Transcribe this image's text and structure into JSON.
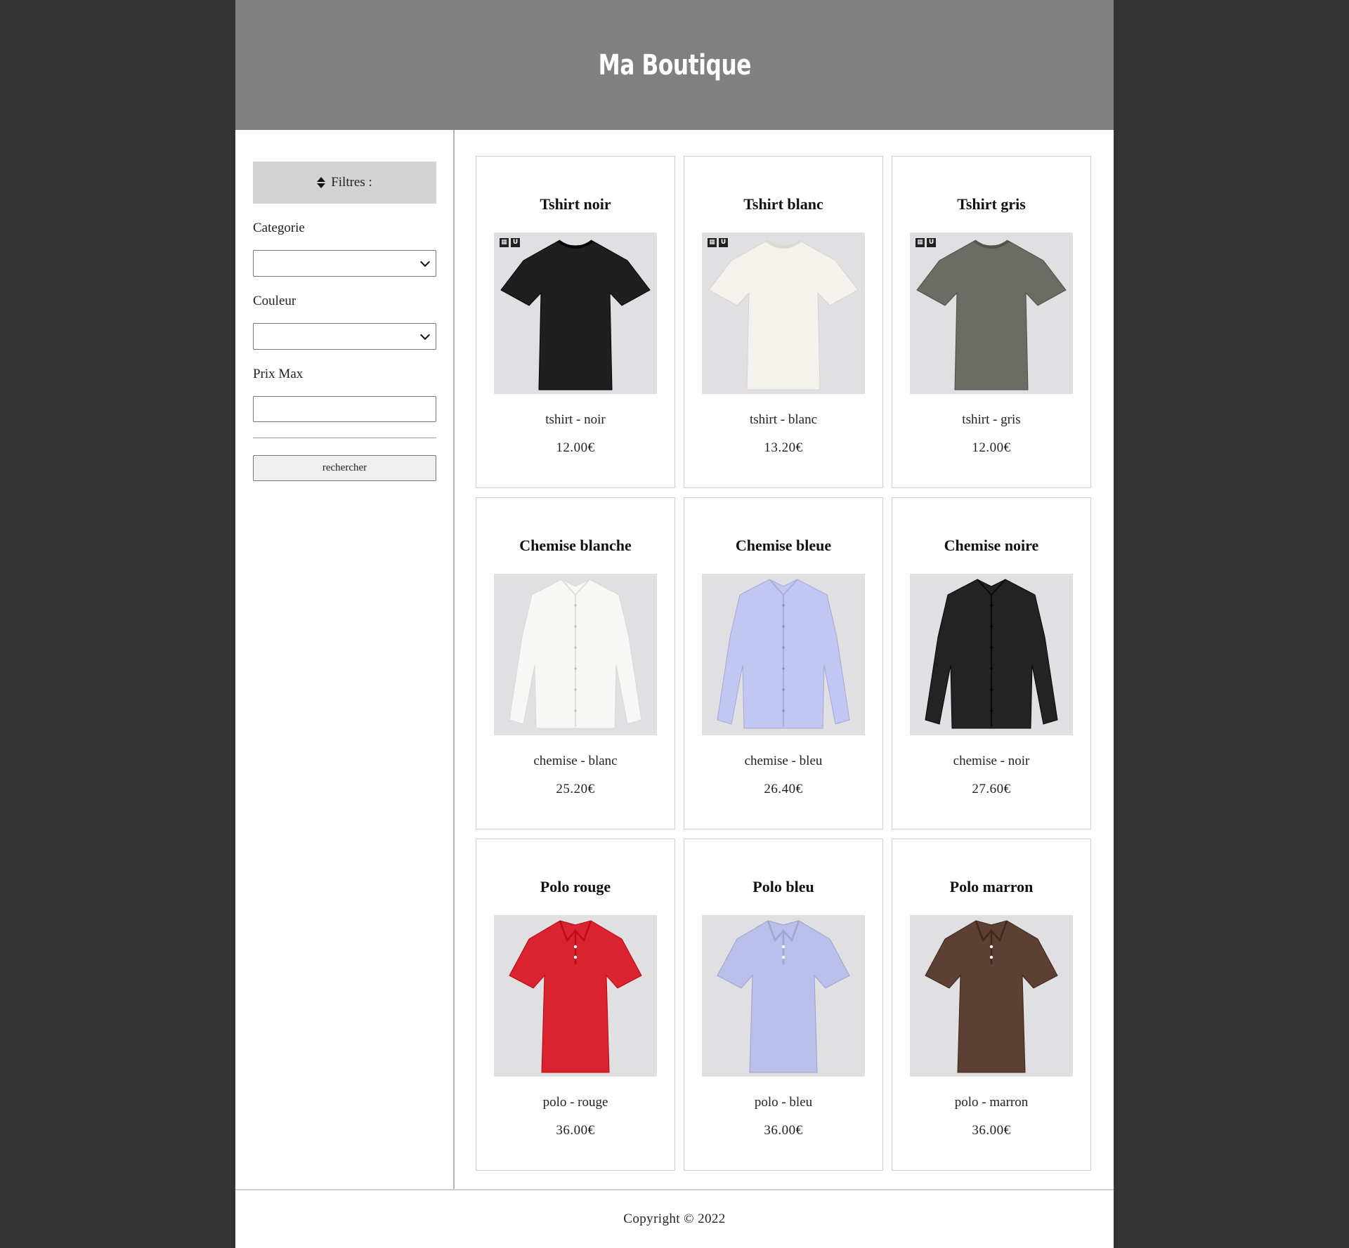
{
  "header": {
    "title": "Ma Boutique"
  },
  "sidebar": {
    "filter_toggle_label": "Filtres :",
    "category_label": "Categorie",
    "category_value": "",
    "color_label": "Couleur",
    "color_value": "",
    "max_price_label": "Prix Max",
    "max_price_value": "",
    "search_button_label": "rechercher"
  },
  "products": [
    {
      "title": "Tshirt noir",
      "subtitle": "tshirt - noir",
      "price": "12.00€",
      "kind": "tshirt",
      "color": "#1f1f1f",
      "brand_tags": true
    },
    {
      "title": "Tshirt blanc",
      "subtitle": "tshirt - blanc",
      "price": "13.20€",
      "kind": "tshirt",
      "color": "#f4f2ec",
      "brand_tags": true
    },
    {
      "title": "Tshirt gris",
      "subtitle": "tshirt - gris",
      "price": "12.00€",
      "kind": "tshirt",
      "color": "#6b6c63",
      "brand_tags": true
    },
    {
      "title": "Chemise blanche",
      "subtitle": "chemise - blanc",
      "price": "25.20€",
      "kind": "shirt",
      "color": "#f7f7f6",
      "brand_tags": false
    },
    {
      "title": "Chemise bleue",
      "subtitle": "chemise - bleu",
      "price": "26.40€",
      "kind": "shirt",
      "color": "#c3c6f2",
      "brand_tags": false
    },
    {
      "title": "Chemise noire",
      "subtitle": "chemise - noir",
      "price": "27.60€",
      "kind": "shirt",
      "color": "#232323",
      "brand_tags": false
    },
    {
      "title": "Polo rouge",
      "subtitle": "polo - rouge",
      "price": "36.00€",
      "kind": "polo",
      "color": "#d92430",
      "brand_tags": false
    },
    {
      "title": "Polo bleu",
      "subtitle": "polo - bleu",
      "price": "36.00€",
      "kind": "polo",
      "color": "#b9bfe8",
      "brand_tags": false
    },
    {
      "title": "Polo marron",
      "subtitle": "polo - marron",
      "price": "36.00€",
      "kind": "polo",
      "color": "#5d4034",
      "brand_tags": false
    }
  ],
  "footer": {
    "text": "Copyright © 2022"
  }
}
